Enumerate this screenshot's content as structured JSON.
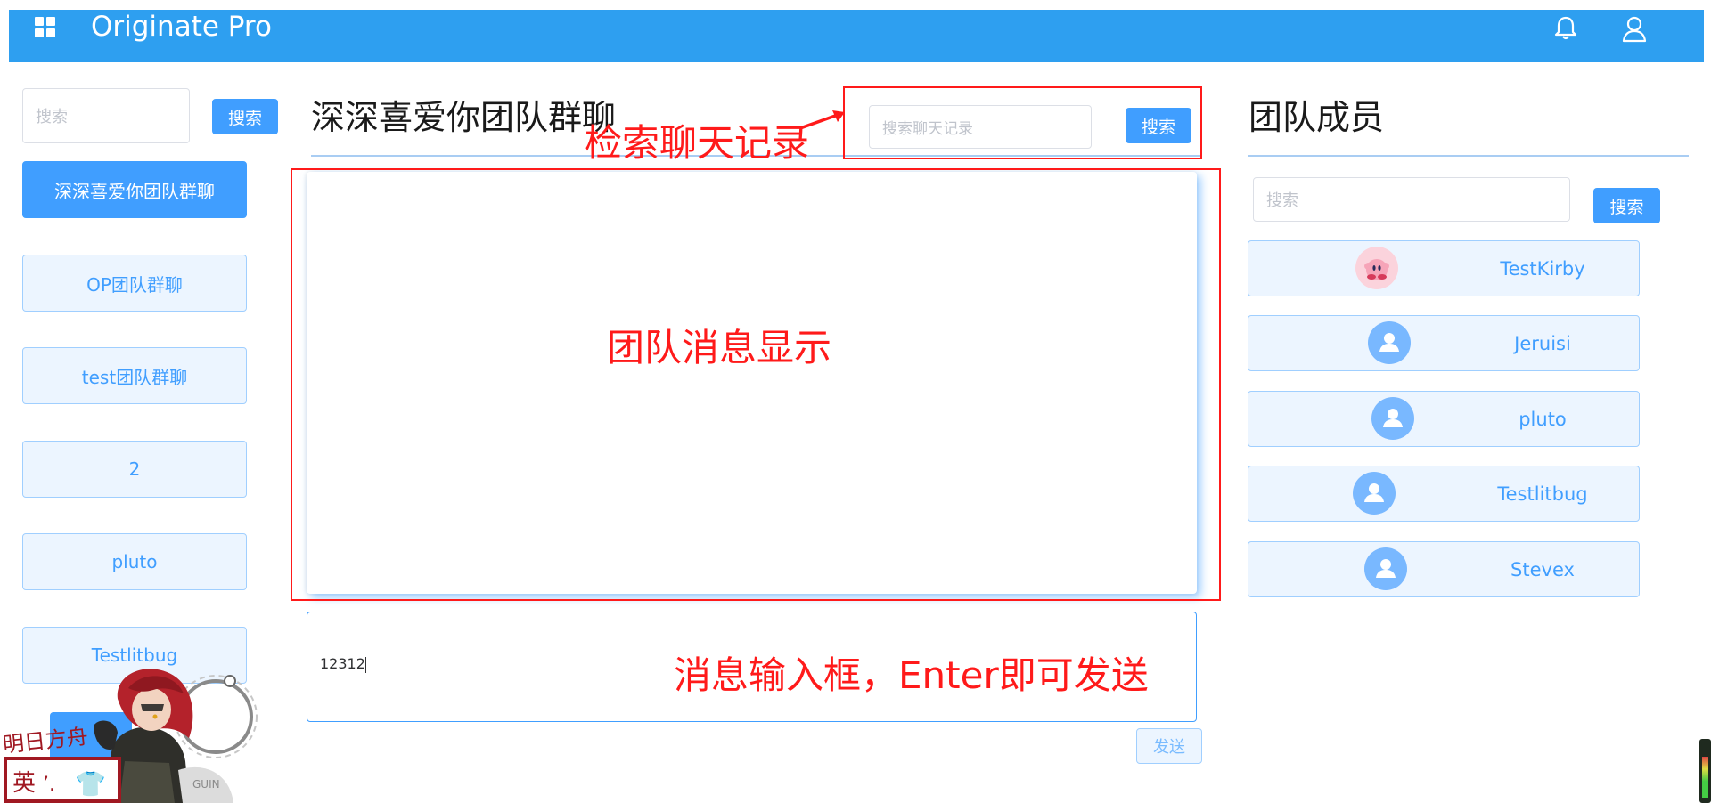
{
  "header": {
    "app_title": "Originate Pro",
    "icons": [
      "grid-icon",
      "bell-icon",
      "user-icon"
    ]
  },
  "sidebar": {
    "search_placeholder": "搜索",
    "search_button": "搜索",
    "groups": [
      {
        "label": "深深喜爱你团队群聊",
        "active": true
      },
      {
        "label": "OP团队群聊",
        "active": false
      },
      {
        "label": "test团队群聊",
        "active": false
      },
      {
        "label": "2",
        "active": false
      },
      {
        "label": "pluto",
        "active": false
      },
      {
        "label": "Testlitbug",
        "active": false
      }
    ]
  },
  "chat": {
    "title": "深深喜爱你团队群聊",
    "history_search_placeholder": "搜索聊天记录",
    "history_search_button": "搜索",
    "input_value": "12312",
    "send_button": "发送"
  },
  "members": {
    "title": "团队成员",
    "search_placeholder": "搜索",
    "search_button": "搜索",
    "list": [
      {
        "name": "TestKirby",
        "avatar": "kirby-avatar"
      },
      {
        "name": "Jeruisi",
        "avatar": "default-user-avatar"
      },
      {
        "name": "pluto",
        "avatar": "default-user-avatar"
      },
      {
        "name": "Testlitbug",
        "avatar": "default-user-avatar"
      },
      {
        "name": "Stevex",
        "avatar": "default-user-avatar"
      }
    ]
  },
  "annotations": {
    "search_history": "检索聊天记录",
    "message_display": "团队消息显示",
    "message_input": "消息输入框，Enter即可发送"
  },
  "sticker": {
    "text_line1": "明日方舟",
    "text_line2": "英",
    "text_line3": "GUIN"
  },
  "colors": {
    "header_bg": "#2e9ff0",
    "primary": "#409eff",
    "plain_bg": "#ecf5ff",
    "plain_border": "#a0cfff",
    "annotation_red": "#ff1a1a"
  }
}
